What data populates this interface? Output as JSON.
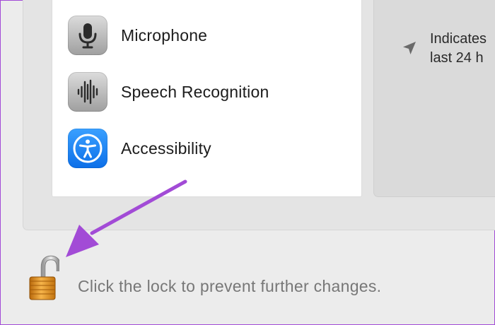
{
  "privacy_list": {
    "items": [
      {
        "label": "Microphone",
        "icon": "microphone-icon"
      },
      {
        "label": "Speech Recognition",
        "icon": "waveform-icon"
      },
      {
        "label": "Accessibility",
        "icon": "accessibility-icon"
      }
    ]
  },
  "info_panel": {
    "icon": "location-arrow-icon",
    "line1": "Indicates",
    "line2": "last 24 h"
  },
  "lock": {
    "icon": "unlocked-padlock-icon",
    "label": "Click the lock to prevent further changes."
  },
  "annotation": {
    "icon": "pointer-arrow-icon",
    "color": "#a24bd6"
  }
}
